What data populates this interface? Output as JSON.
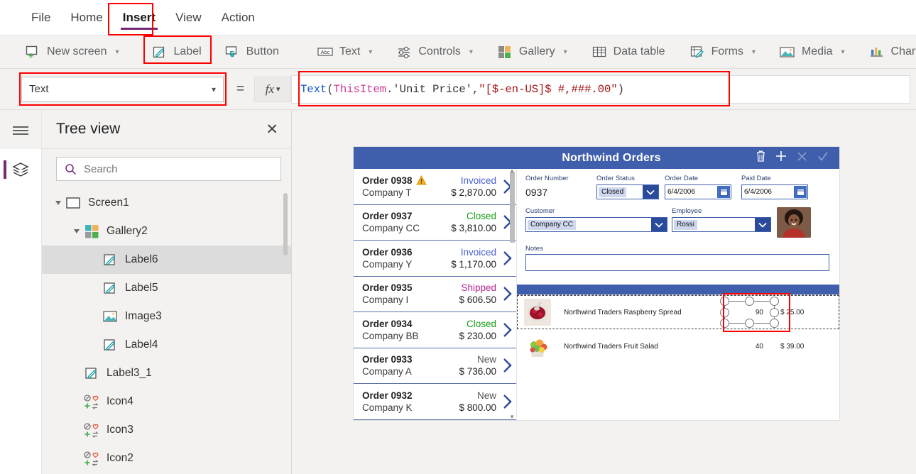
{
  "menu": {
    "items": [
      {
        "label": "File",
        "active": false
      },
      {
        "label": "Home",
        "active": false
      },
      {
        "label": "Insert",
        "active": true
      },
      {
        "label": "View",
        "active": false
      },
      {
        "label": "Action",
        "active": false
      }
    ]
  },
  "ribbon": {
    "items": [
      {
        "label": "New screen",
        "icon": "new-screen-icon",
        "caret": true
      },
      {
        "label": "Label",
        "icon": "label-icon",
        "caret": false
      },
      {
        "label": "Button",
        "icon": "button-icon",
        "caret": false
      },
      {
        "label": "Text",
        "icon": "text-icon",
        "caret": true
      },
      {
        "label": "Controls",
        "icon": "controls-icon",
        "caret": true
      },
      {
        "label": "Gallery",
        "icon": "gallery-icon",
        "caret": true
      },
      {
        "label": "Data table",
        "icon": "data-table-icon",
        "caret": false
      },
      {
        "label": "Forms",
        "icon": "forms-icon",
        "caret": true
      },
      {
        "label": "Media",
        "icon": "media-icon",
        "caret": true
      },
      {
        "label": "Charts",
        "icon": "charts-icon",
        "caret": false
      }
    ]
  },
  "formula_bar": {
    "property": "Text",
    "equals": "=",
    "fx_label": "fx",
    "formula_tokens": [
      {
        "text": "Text",
        "type": "fn"
      },
      {
        "text": "( ",
        "type": "pun"
      },
      {
        "text": "ThisItem",
        "type": "obj"
      },
      {
        "text": ".'Unit Price', ",
        "type": "pun"
      },
      {
        "text": "\"[$-en-US]$ #,###.00\"",
        "type": "str"
      },
      {
        "text": " )",
        "type": "pun"
      }
    ],
    "formula_plain": "Text( ThisItem.'Unit Price', \"[$-en-US]$ #,###.00\" )"
  },
  "tree_view": {
    "title": "Tree view",
    "search_placeholder": "Search",
    "nodes": [
      {
        "label": "Screen1",
        "icon": "screen-icon",
        "depth": 0,
        "expander": true,
        "selected": false
      },
      {
        "label": "Gallery2",
        "icon": "gallery-icon",
        "depth": 1,
        "expander": true,
        "selected": false
      },
      {
        "label": "Label6",
        "icon": "label-icon",
        "depth": 2,
        "expander": false,
        "selected": true
      },
      {
        "label": "Label5",
        "icon": "label-icon",
        "depth": 2,
        "expander": false,
        "selected": false
      },
      {
        "label": "Image3",
        "icon": "image-icon",
        "depth": 2,
        "expander": false,
        "selected": false
      },
      {
        "label": "Label4",
        "icon": "label-icon",
        "depth": 2,
        "expander": false,
        "selected": false
      },
      {
        "label": "Label3_1",
        "icon": "label-icon",
        "depth": 1,
        "expander": false,
        "selected": false
      },
      {
        "label": "Icon4",
        "icon": "icon-set-icon",
        "depth": 1,
        "expander": false,
        "selected": false
      },
      {
        "label": "Icon3",
        "icon": "icon-set-icon",
        "depth": 1,
        "expander": false,
        "selected": false
      },
      {
        "label": "Icon2",
        "icon": "icon-set-icon",
        "depth": 1,
        "expander": false,
        "selected": false
      }
    ]
  },
  "canvas_app": {
    "title": "Northwind Orders",
    "header_color": "#3f5fad",
    "actions": [
      {
        "name": "delete-icon",
        "enabled": true
      },
      {
        "name": "add-icon",
        "enabled": true
      },
      {
        "name": "cancel-icon",
        "enabled": false
      },
      {
        "name": "confirm-icon",
        "enabled": false
      }
    ],
    "orders": [
      {
        "id": "Order 0938",
        "company": "Company T",
        "status": "Invoiced",
        "amount": "$ 2,870.00",
        "warning": true
      },
      {
        "id": "Order 0937",
        "company": "Company CC",
        "status": "Closed",
        "amount": "$ 3,810.00",
        "warning": false
      },
      {
        "id": "Order 0936",
        "company": "Company Y",
        "status": "Invoiced",
        "amount": "$ 1,170.00",
        "warning": false
      },
      {
        "id": "Order 0935",
        "company": "Company I",
        "status": "Shipped",
        "amount": "$ 606.50",
        "warning": false
      },
      {
        "id": "Order 0934",
        "company": "Company BB",
        "status": "Closed",
        "amount": "$ 230.00",
        "warning": false
      },
      {
        "id": "Order 0933",
        "company": "Company A",
        "status": "New",
        "amount": "$ 736.00",
        "warning": false
      },
      {
        "id": "Order 0932",
        "company": "Company K",
        "status": "New",
        "amount": "$ 800.00",
        "warning": false
      }
    ],
    "form": {
      "order_number_label": "Order Number",
      "order_number_value": "0937",
      "order_status_label": "Order Status",
      "order_status_value": "Closed",
      "order_date_label": "Order Date",
      "order_date_value": "6/4/2006",
      "paid_date_label": "Paid Date",
      "paid_date_value": "6/4/2006",
      "customer_label": "Customer",
      "customer_value": "Company CC",
      "employee_label": "Employee",
      "employee_value": "Rossi",
      "notes_label": "Notes",
      "notes_value": ""
    },
    "order_details": [
      {
        "product": "Northwind Traders Raspberry Spread",
        "qty": "90",
        "price": "$ 25.00",
        "selected": true
      },
      {
        "product": "Northwind Traders Fruit Salad",
        "qty": "40",
        "price": "$ 39.00",
        "selected": false
      }
    ]
  },
  "annotations": {
    "color": "#ff0000",
    "boxes": [
      "insert-tab",
      "label-ribbon-button",
      "property-selector",
      "formula-input",
      "selected-label-on-canvas"
    ]
  }
}
